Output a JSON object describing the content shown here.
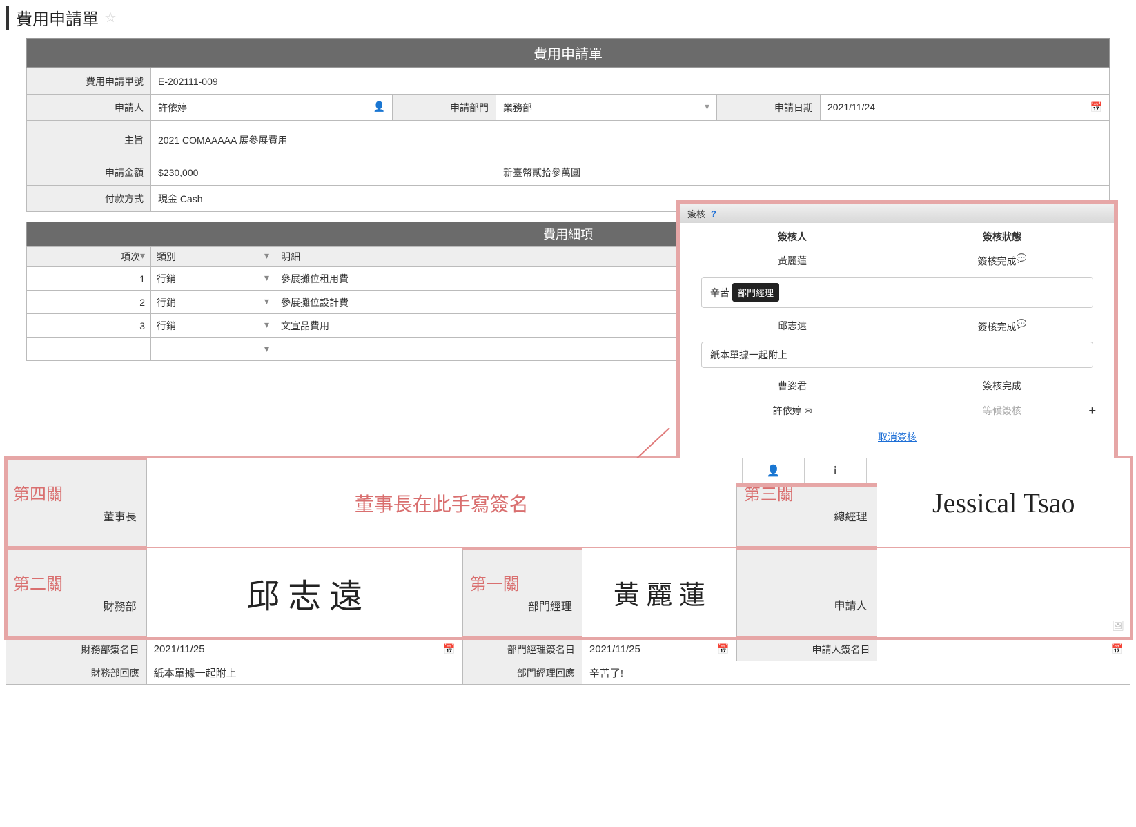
{
  "page_title": "費用申請單",
  "form": {
    "header": "費用申請單",
    "labels": {
      "form_no": "費用申請單號",
      "applicant": "申請人",
      "dept": "申請部門",
      "apply_date": "申請日期",
      "subject": "主旨",
      "amount": "申請金額",
      "pay_method": "付款方式"
    },
    "values": {
      "form_no": "E-202111-009",
      "applicant": "許依婷",
      "dept": "業務部",
      "apply_date": "2021/11/24",
      "subject": "2021 COMAAAAA 展參展費用",
      "amount": "$230,000",
      "amount_cn": "新臺幣貳拾參萬圓",
      "pay_method": "現金 Cash"
    }
  },
  "detail": {
    "header": "費用細項",
    "cols": {
      "idx": "項次",
      "cat": "類別",
      "desc": "明細"
    },
    "rows": [
      {
        "idx": "1",
        "cat": "行銷",
        "desc": "參展攤位租用費"
      },
      {
        "idx": "2",
        "cat": "行銷",
        "desc": "參展攤位設計費"
      },
      {
        "idx": "3",
        "cat": "行銷",
        "desc": "文宣品費用"
      }
    ]
  },
  "popup": {
    "title": "簽核",
    "col_signer": "簽核人",
    "col_status": "簽核狀態",
    "rows": [
      {
        "name": "黃麗蓮",
        "status": "簽核完成",
        "bubble": true,
        "note_prefix": "辛苦",
        "tooltip": "部門經理"
      },
      {
        "name": "邱志遠",
        "status": "簽核完成",
        "bubble": true,
        "note": "紙本單據一起附上"
      },
      {
        "name": "曹姿君",
        "status": "簽核完成"
      },
      {
        "name": "許依婷",
        "status": "等候簽核",
        "waiting": true,
        "envelope": true,
        "plus": true
      }
    ],
    "cancel": "取消簽核"
  },
  "sig": {
    "stage4": {
      "stage": "第四關",
      "role": "董事長",
      "placeholder": "董事長在此手寫簽名"
    },
    "stage3": {
      "stage": "第三關",
      "role": "總經理",
      "signature": "Jessical Tsao"
    },
    "stage2": {
      "stage": "第二關",
      "role": "財務部",
      "signature": "邱 志 遠"
    },
    "stage1": {
      "stage": "第一關",
      "role": "部門經理",
      "signature": "黃 麗 蓮"
    },
    "applicant": {
      "role": "申請人"
    },
    "bottom": {
      "fin_date_lbl": "財務部簽名日",
      "fin_date": "2021/11/25",
      "mgr_date_lbl": "部門經理簽名日",
      "mgr_date": "2021/11/25",
      "app_date_lbl": "申請人簽名日",
      "app_date": "",
      "fin_resp_lbl": "財務部回應",
      "fin_resp": "紙本單據一起附上",
      "mgr_resp_lbl": "部門經理回應",
      "mgr_resp": "辛苦了!"
    }
  }
}
